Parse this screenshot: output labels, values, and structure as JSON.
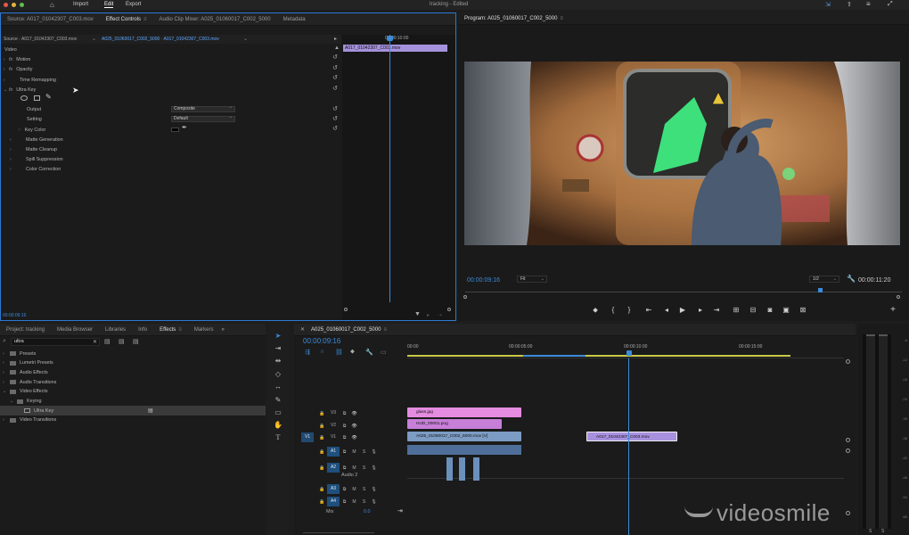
{
  "app": {
    "menu": [
      "Import",
      "Edit",
      "Export"
    ],
    "active_menu": "Edit",
    "title": "tracking",
    "title_suffix": " - Edited"
  },
  "source_panel": {
    "tabs": [
      "Source: A017_01042307_C003.mov",
      "Effect Controls",
      "Audio Clip Mixer: A025_01060017_C002_5000",
      "Metadata"
    ],
    "active_tab": "Effect Controls",
    "source_dropdown": "Source · A017_01042307_C003.mov",
    "clip_dropdown": "A025_01060017_C002_5000 · A017_01042307_C003.mov",
    "timecode_ruler": "00:00:10:00",
    "clip_label": "A017_01042307_C003.mov",
    "section": "Video",
    "effects": [
      {
        "label": "Motion",
        "fx": "fx"
      },
      {
        "label": "Opacity",
        "fx": "fx"
      },
      {
        "label": "Time Remapping",
        "fx": ""
      },
      {
        "label": "Ultra Key",
        "fx": "fx"
      }
    ],
    "ultra_key": {
      "output_label": "Output",
      "output_value": "Composite",
      "setting_label": "Setting",
      "setting_value": "Default",
      "key_color_label": "Key Color",
      "key_color_hex": "#000000",
      "groups": [
        "Matte Generation",
        "Matte Cleanup",
        "Spill Suppression",
        "Color Correction"
      ]
    },
    "timecode": "00:00:09:16"
  },
  "program_monitor": {
    "title": "Program: A025_01060017_C002_5000",
    "timecode": "00:00:09:16",
    "fit": "Fit",
    "resolution": "1/2",
    "duration": "00:00:11:20"
  },
  "project_panel": {
    "tabs": [
      "Project: tracking",
      "Media Browser",
      "Libraries",
      "Info",
      "Effects",
      "Markers"
    ],
    "active_tab": "Effects",
    "search_value": "ultra",
    "tree": [
      {
        "label": "Presets",
        "level": 0,
        "open": false
      },
      {
        "label": "Lumetri Presets",
        "level": 0,
        "open": false
      },
      {
        "label": "Audio Effects",
        "level": 0,
        "open": false
      },
      {
        "label": "Audio Transitions",
        "level": 0,
        "open": false
      },
      {
        "label": "Video Effects",
        "level": 0,
        "open": true
      },
      {
        "label": "Keying",
        "level": 1,
        "open": true
      },
      {
        "label": "Ultra Key",
        "level": 2,
        "selected": true
      },
      {
        "label": "Video Transitions",
        "level": 0,
        "open": false
      }
    ]
  },
  "timeline": {
    "sequence_tab": "A025_01060017_C002_5000",
    "timecode": "00:00:09:16",
    "ruler": [
      "00:00",
      "00:00:05:00",
      "00:00:10:00",
      "00:00:15:00"
    ],
    "tracks": [
      {
        "id": "V3",
        "type": "video"
      },
      {
        "id": "V2",
        "type": "video"
      },
      {
        "id": "V1",
        "type": "video",
        "source": "V1"
      },
      {
        "id": "A1",
        "type": "audio"
      },
      {
        "id": "A2",
        "type": "audio",
        "name": "Audio 2"
      },
      {
        "id": "A3",
        "type": "audio"
      },
      {
        "id": "A4",
        "type": "audio"
      }
    ],
    "mix_label": "Mix",
    "mix_value": "0.0",
    "audio_toggles": {
      "m": "M",
      "s": "S"
    },
    "clips": [
      {
        "label": "glass.jpg",
        "track": "V3",
        "color": "#e58be0"
      },
      {
        "label": "HUD_00001.png",
        "track": "V2",
        "color": "#c77fd8"
      },
      {
        "label": "A025_01060017_C002_5000.mov [V]",
        "track": "V1",
        "color": "#7d9cc4"
      },
      {
        "label": "A017_01042307_C003.mov",
        "track": "V1",
        "color": "#a791df"
      }
    ]
  },
  "audio_meter": {
    "scale": [
      "-6",
      "-12",
      "-18",
      "-24",
      "-30",
      "-36",
      "-42",
      "-48",
      "-54",
      "dB"
    ],
    "solo": [
      "S",
      "S"
    ]
  },
  "watermark": "videosmile",
  "colors": {
    "accent_blue": "#2d8ceb",
    "playhead": "#3b8bd8",
    "panel_bg": "#1d1d1d"
  }
}
